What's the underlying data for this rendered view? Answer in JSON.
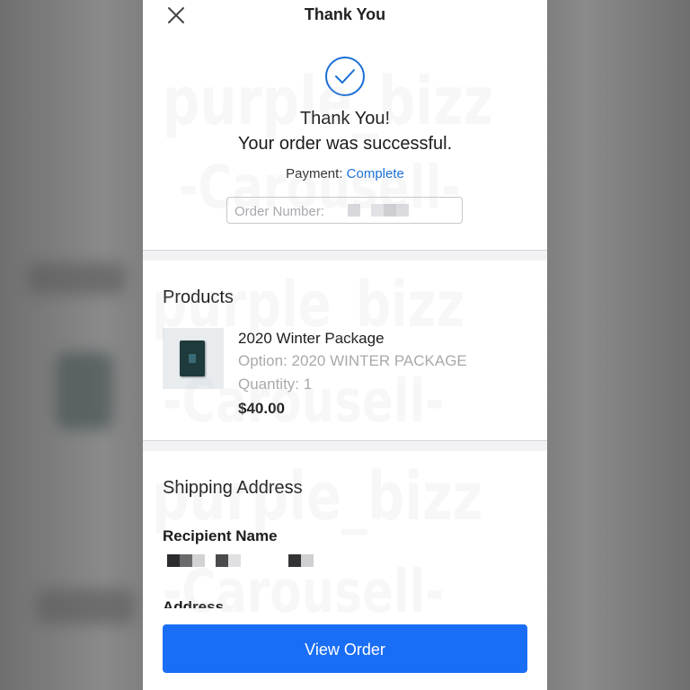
{
  "header": {
    "title": "Thank You",
    "close_icon": "close-icon"
  },
  "confirmation": {
    "icon": "check-circle-icon",
    "thank_you": "Thank You!",
    "message": "Your order was successful.",
    "payment_label": "Payment: ",
    "payment_value": "Complete",
    "order_number_label": "Order Number: "
  },
  "products": {
    "title": "Products",
    "items": [
      {
        "name": "2020 Winter Package",
        "option": "Option: 2020 WINTER PACKAGE",
        "quantity": "Quantity: 1",
        "price": "$40.00",
        "thumbnail_icon": "album-box-icon"
      }
    ]
  },
  "shipping": {
    "title": "Shipping Address",
    "recipient_label": "Recipient Name",
    "address_label": "Address"
  },
  "footer": {
    "view_order_label": "View Order"
  },
  "watermark": {
    "line1": "purple_bizz",
    "line2": "-Carousell-"
  },
  "colors": {
    "accent": "#1a6ef5",
    "link": "#1a6fd6",
    "background": "#f2f2f4"
  }
}
